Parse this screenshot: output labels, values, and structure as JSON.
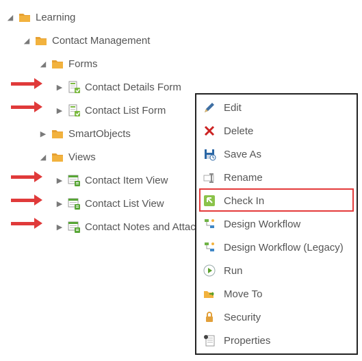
{
  "tree": {
    "root": {
      "label": "Learning",
      "expanded": true
    },
    "cm": {
      "label": "Contact Management",
      "expanded": true
    },
    "forms": {
      "label": "Forms",
      "expanded": true
    },
    "form_details": {
      "label": "Contact Details Form"
    },
    "form_list": {
      "label": "Contact List Form"
    },
    "smartobjects": {
      "label": "SmartObjects"
    },
    "views": {
      "label": "Views",
      "expanded": true
    },
    "view_item": {
      "label": "Contact Item View"
    },
    "view_list": {
      "label": "Contact List View"
    },
    "view_notes": {
      "label": "Contact Notes and Attachments Item View"
    }
  },
  "menu": {
    "edit": "Edit",
    "delete": "Delete",
    "saveas": "Save As",
    "rename": "Rename",
    "checkin": "Check In",
    "design_wf": "Design Workflow",
    "design_wf_legacy": "Design Workflow (Legacy)",
    "run": "Run",
    "moveto": "Move To",
    "security": "Security",
    "properties": "Properties"
  },
  "colors": {
    "arrow": "#e03a3a",
    "highlight": "#e43a3a",
    "folder": "#f2b23e"
  }
}
